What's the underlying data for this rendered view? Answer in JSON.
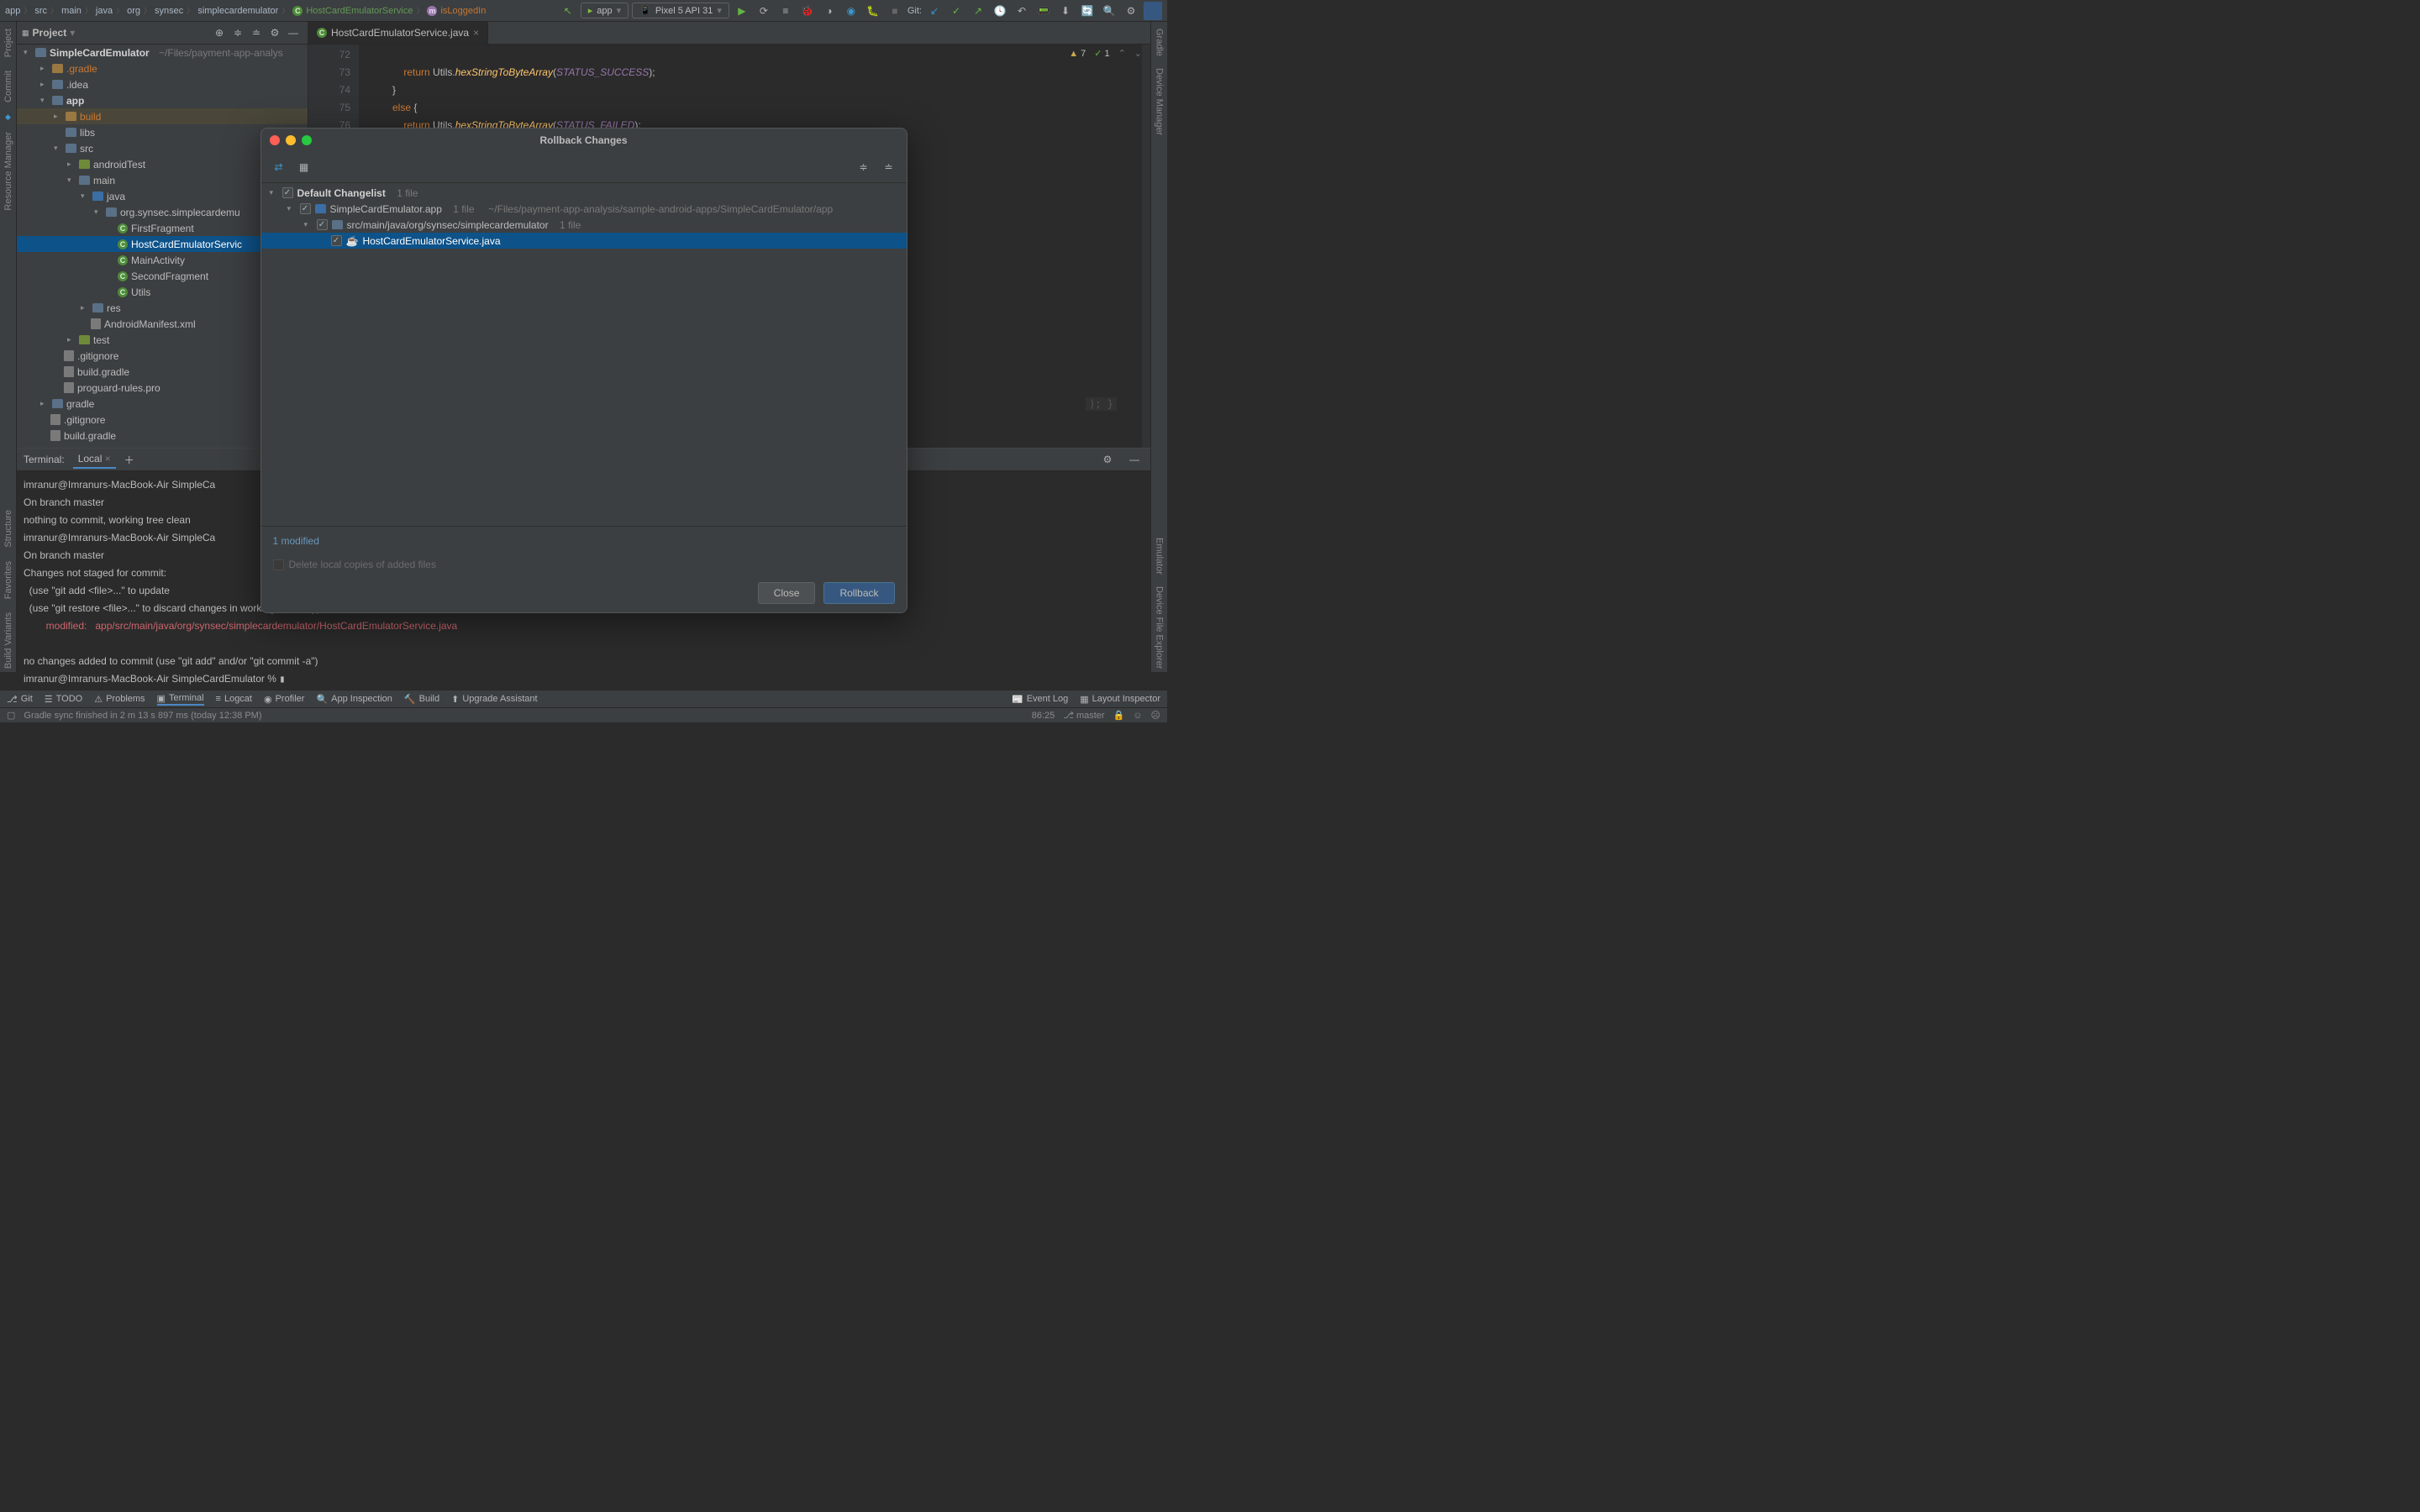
{
  "breadcrumbs": [
    "app",
    "src",
    "main",
    "java",
    "org",
    "synsec",
    "simplecardemulator"
  ],
  "bc_class": "HostCardEmulatorService",
  "bc_method": "isLoggedIn",
  "run_config": "app",
  "device": "Pixel 5 API 31",
  "git_label": "Git:",
  "project_label": "Project",
  "tab": {
    "name": "HostCardEmulatorService.java"
  },
  "tree": {
    "root": "SimpleCardEmulator",
    "root_path": "~/Files/payment-app-analys",
    "gradle": ".gradle",
    "idea": ".idea",
    "app": "app",
    "build": "build",
    "libs": "libs",
    "src": "src",
    "androidTest": "androidTest",
    "main": "main",
    "java": "java",
    "pkg": "org.synsec.simplecardemu",
    "f1": "FirstFragment",
    "f2": "HostCardEmulatorServic",
    "f3": "MainActivity",
    "f4": "SecondFragment",
    "f5": "Utils",
    "res": "res",
    "manifest": "AndroidManifest.xml",
    "test": "test",
    "gitignore": ".gitignore",
    "bgradle": "build.gradle",
    "proguard": "proguard-rules.pro",
    "gradle2": "gradle",
    "gitignore2": ".gitignore",
    "bgradle2": "build.gradle"
  },
  "code": {
    "lines": [
      "72",
      "73",
      "74",
      "75",
      "76"
    ],
    "l72a": "                return ",
    "l72b": "Utils.",
    "l72c": "hexStringToByteArray",
    "l72d": "(",
    "l72e": "STATUS_SUCCESS",
    "l72f": ");",
    "l73": "            }",
    "l74a": "            else ",
    "l74b": "{",
    "l75a": "                return ",
    "l75b": "Utils.",
    "l75c": "hexStringToByteArray",
    "l75d": "(",
    "l75e": "STATUS_FAILED",
    "l75f": ");",
    "l76": "            }",
    "hint": ");  }"
  },
  "insp": {
    "warn": "7",
    "ok": "1"
  },
  "terminal": {
    "title": "Terminal:",
    "tab": "Local",
    "l1": "imranur@Imranurs-MacBook-Air SimpleCa",
    "l2": "On branch master",
    "l3": "nothing to commit, working tree clean",
    "l4": "imranur@Imranurs-MacBook-Air SimpleCa",
    "l5": "On branch master",
    "l6": "Changes not staged for commit:",
    "l7": "  (use \"git add <file>...\" to update",
    "l8": "  (use \"git restore <file>...\" to discard changes in working directory)",
    "l9a": "        modified:   ",
    "l9b": "app/src/main/java/org/synsec/simplecardemulator/HostCardEmulatorService.java",
    "l10": "",
    "l11": "no changes added to commit (use \"git add\" and/or \"git commit -a\")",
    "l12": "imranur@Imranurs-MacBook-Air SimpleCardEmulator % "
  },
  "modal": {
    "title": "Rollback Changes",
    "changelist": "Default Changelist",
    "file_count": "1 file",
    "module": "SimpleCardEmulator.app",
    "module_count": "1 file",
    "module_path": "~/Files/payment-app-analysis/sample-android-apps/SimpleCardEmulator/app",
    "dir": "src/main/java/org/synsec/simplecardemulator",
    "dir_count": "1 file",
    "file": "HostCardEmulatorService.java",
    "summary": "1 modified",
    "delete_cb": "Delete local copies of added files",
    "close": "Close",
    "rollback": "Rollback"
  },
  "bottom": {
    "git": "Git",
    "todo": "TODO",
    "problems": "Problems",
    "terminal": "Terminal",
    "logcat": "Logcat",
    "profiler": "Profiler",
    "appinsp": "App Inspection",
    "build": "Build",
    "upgrade": "Upgrade Assistant",
    "evlog": "Event Log",
    "layout": "Layout Inspector"
  },
  "status": {
    "sync": "Gradle sync finished in 2 m 13 s 897 ms (today 12:38 PM)",
    "pos": "86:25",
    "branch": "master"
  },
  "left_tools": {
    "project": "Project",
    "commit": "Commit",
    "rm": "Resource Manager",
    "structure": "Structure",
    "fav": "Favorites",
    "bv": "Build Variants"
  },
  "right_tools": {
    "gradle": "Gradle",
    "dm": "Device Manager",
    "emu": "Emulator",
    "dfe": "Device File Explorer"
  }
}
